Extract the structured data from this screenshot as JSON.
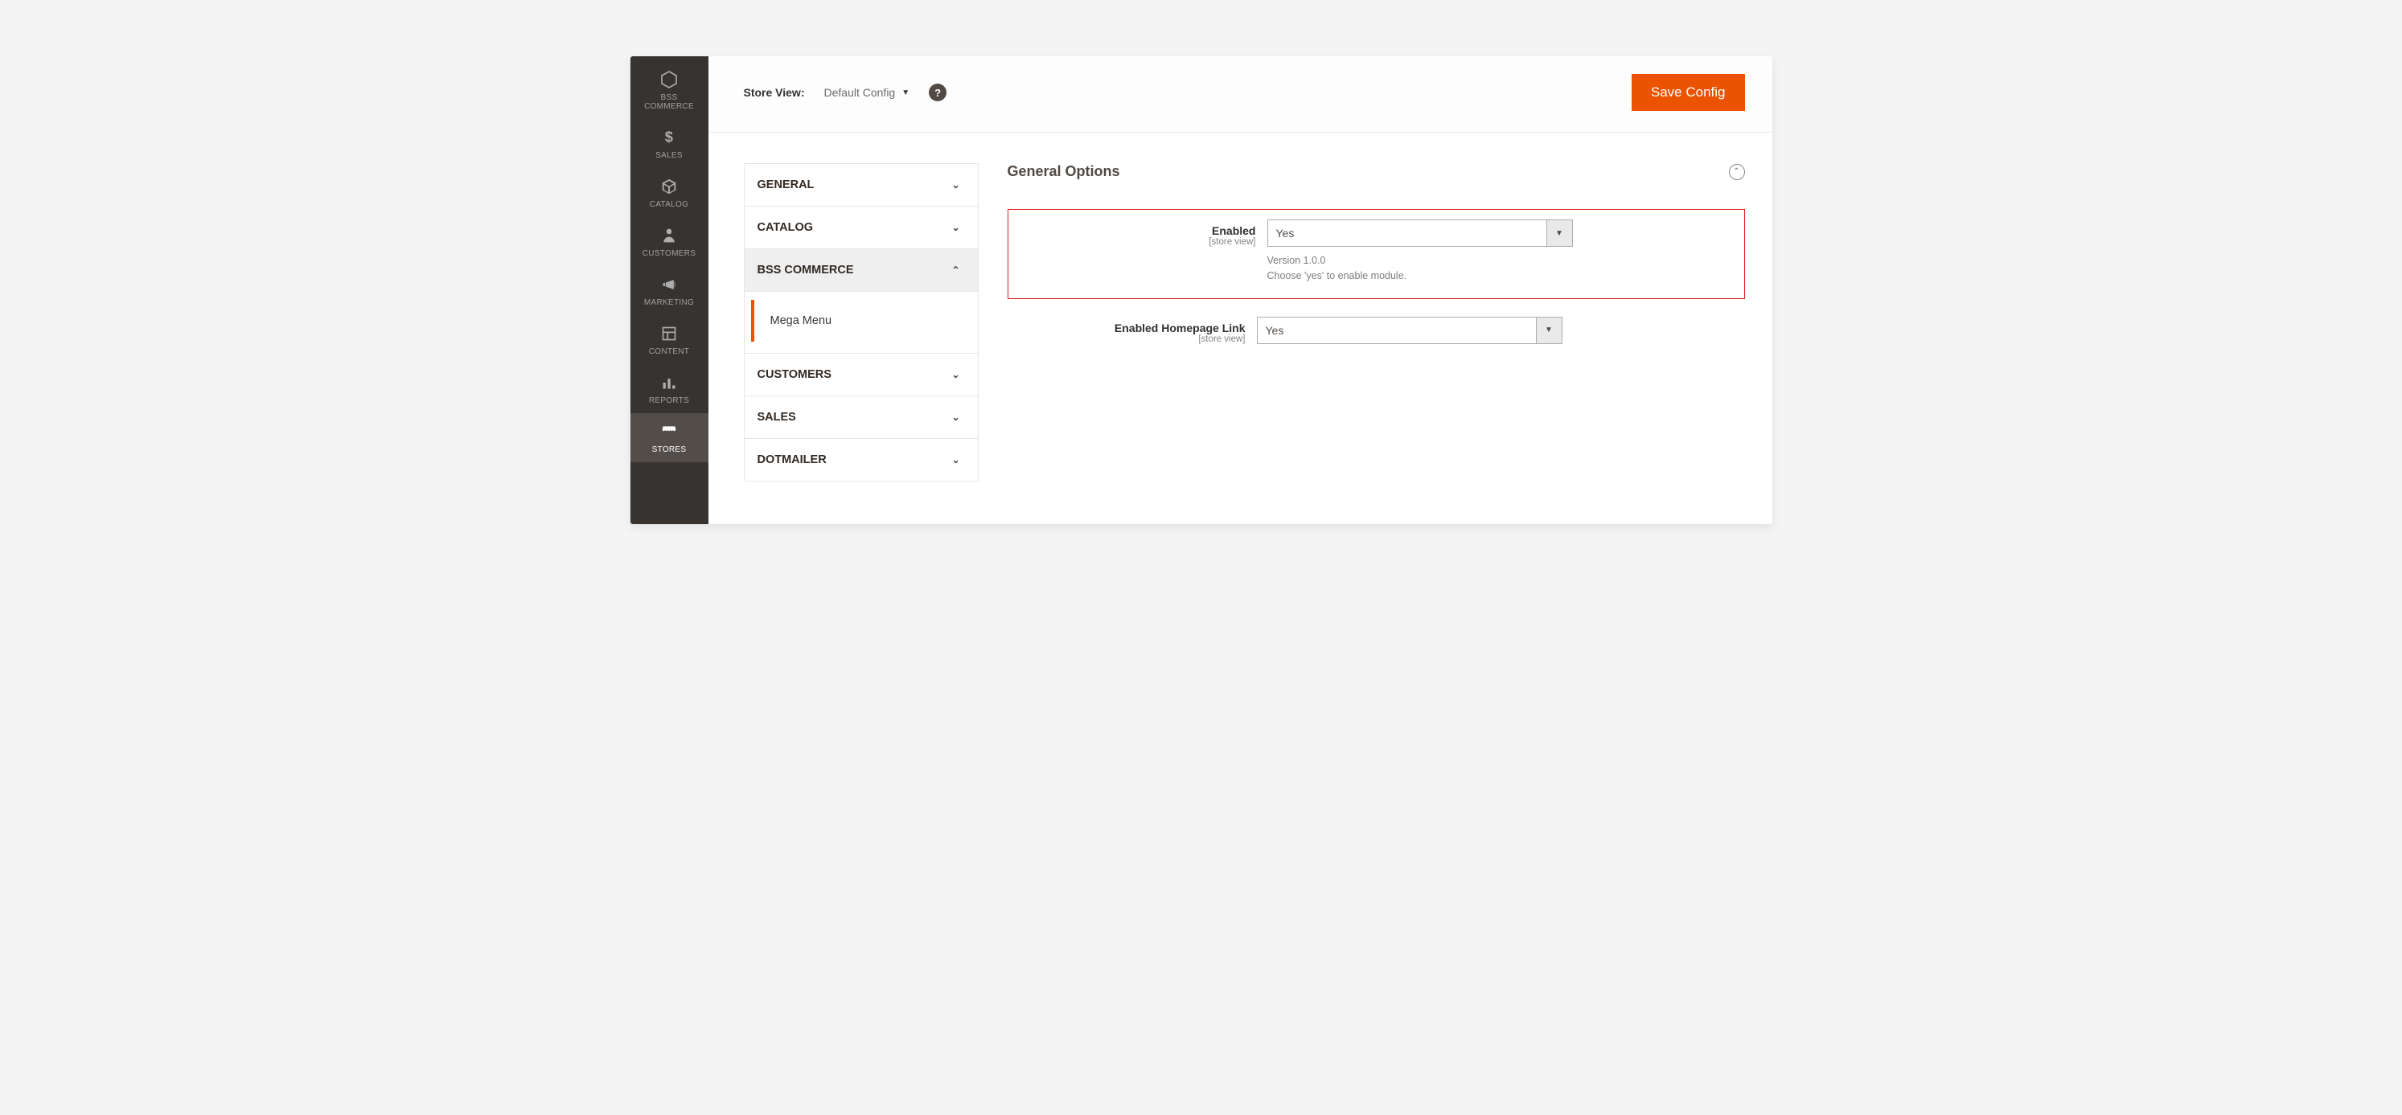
{
  "nav": {
    "items": [
      {
        "label": "BSS\nCOMMERCE",
        "icon": "hexagon"
      },
      {
        "label": "SALES",
        "icon": "dollar"
      },
      {
        "label": "CATALOG",
        "icon": "box"
      },
      {
        "label": "CUSTOMERS",
        "icon": "person"
      },
      {
        "label": "MARKETING",
        "icon": "megaphone"
      },
      {
        "label": "CONTENT",
        "icon": "layout"
      },
      {
        "label": "REPORTS",
        "icon": "bars"
      },
      {
        "label": "STORES",
        "icon": "store"
      }
    ],
    "active_index": 7
  },
  "scope": {
    "label": "Store View:",
    "value": "Default Config"
  },
  "save_button": "Save Config",
  "config_tabs": [
    {
      "label": "GENERAL",
      "open": false
    },
    {
      "label": "CATALOG",
      "open": false
    },
    {
      "label": "BSS COMMERCE",
      "open": true,
      "sub": "Mega Menu"
    },
    {
      "label": "CUSTOMERS",
      "open": false
    },
    {
      "label": "SALES",
      "open": false
    },
    {
      "label": "DOTMAILER",
      "open": false
    }
  ],
  "panel": {
    "title": "General Options",
    "fields": [
      {
        "label": "Enabled",
        "scope": "[store view]",
        "value": "Yes",
        "note_line1": "Version 1.0.0",
        "note_line2": "Choose 'yes' to enable module.",
        "highlight": true
      },
      {
        "label": "Enabled Homepage Link",
        "scope": "[store view]",
        "value": "Yes"
      }
    ]
  },
  "colors": {
    "accent": "#eb5202",
    "nav_bg": "#373330",
    "highlight_border": "#e41f1f"
  }
}
